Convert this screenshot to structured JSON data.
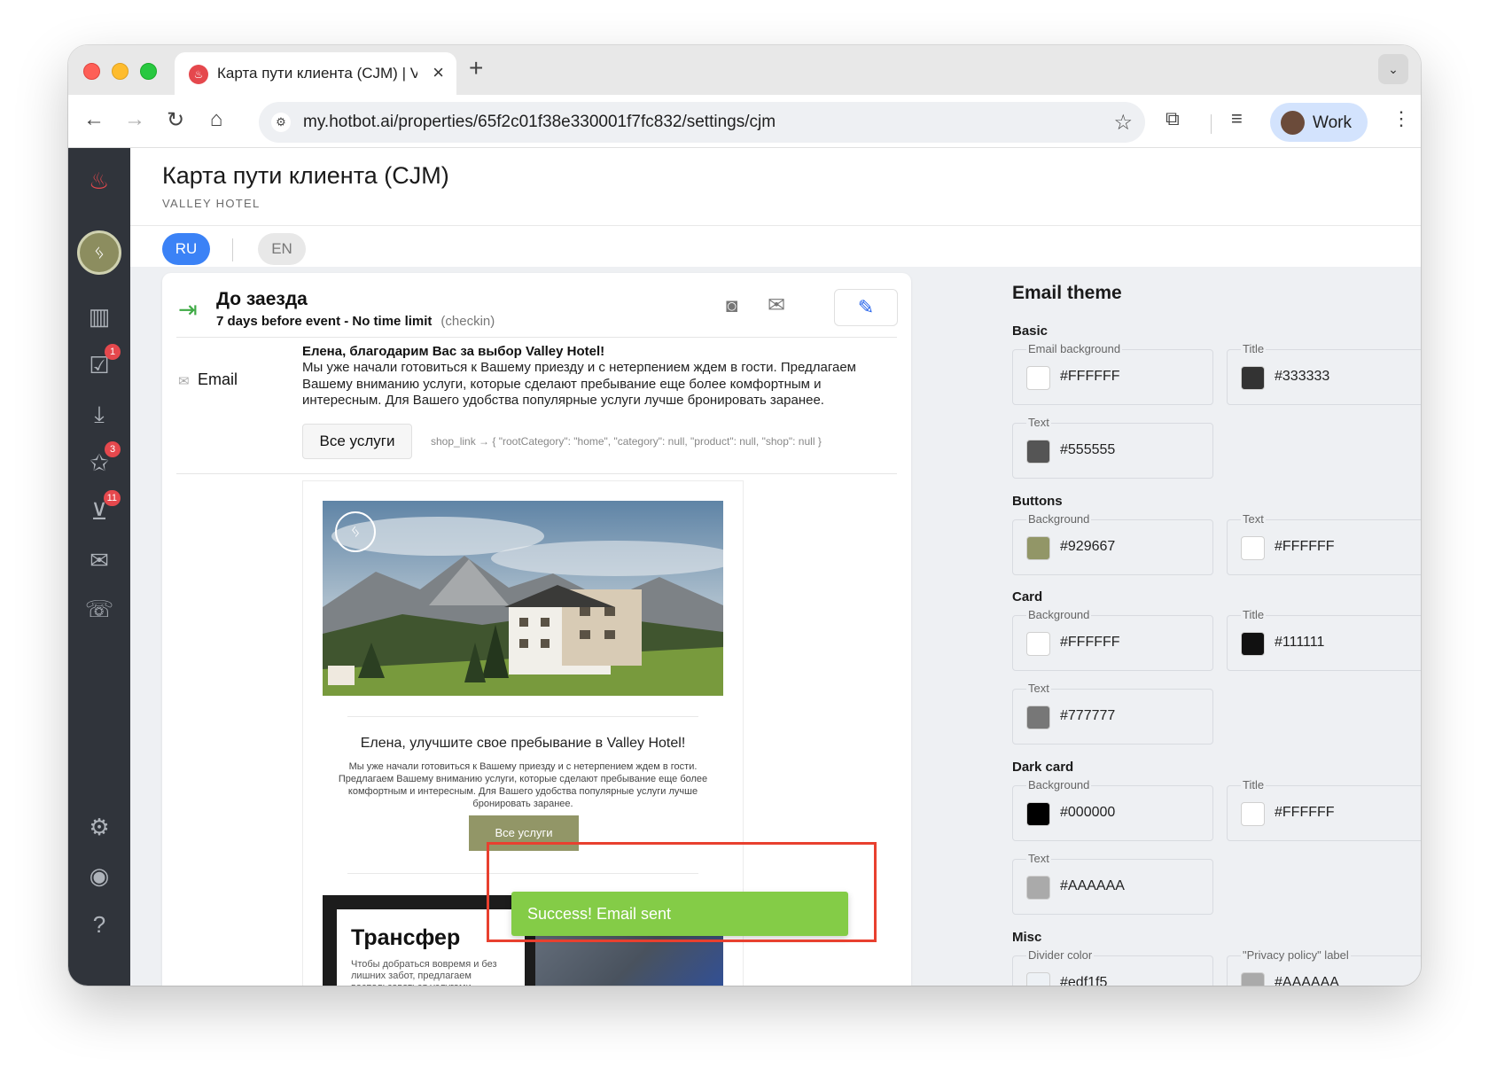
{
  "browser": {
    "tab_title": "Карта пути клиента (CJM) | V",
    "url": "my.hotbot.ai/properties/65f2c01f38e330001f7fc832/settings/cjm",
    "profile_label": "Work"
  },
  "sidebar": {
    "badges": {
      "tasks": "1",
      "reviews": "3",
      "shop": "11"
    }
  },
  "header": {
    "title": "Карта пути клиента (CJM)",
    "subtitle": "VALLEY HOTEL"
  },
  "languages": {
    "active": "RU",
    "inactive": "EN"
  },
  "step": {
    "title": "До заезда",
    "timing": "7 days before event - No time limit",
    "type": "(checkin)",
    "channel": "Email",
    "message_title": "Елена, благодарим Вас за выбор Valley Hotel!",
    "message_body": "Мы уже начали готовиться к Вашему приезду и с нетерпением ждем в гости. Предлагаем Вашему вниманию услуги, которые сделают пребывание еще более комфортным и интересным. Для Вашего удобства популярные услуги лучше бронировать заранее.",
    "button_label": "Все услуги",
    "button_link": "shop_link → { \"rootCategory\": \"home\", \"category\": null, \"product\": null, \"shop\": null }"
  },
  "email_preview": {
    "title": "Елена, улучшите свое пребывание в Valley Hotel!",
    "body": "Мы уже начали готовиться к Вашему приезду и с нетерпением ждем в гости. Предлагаем Вашему вниманию услуги, которые сделают пребывание еще более комфортным и интересным. Для Вашего удобства популярные услуги лучше бронировать заранее.",
    "button_label": "Все услуги",
    "transfer_title": "Трансфер",
    "transfer_body": "Чтобы добраться вовремя и без лишних забот, предлагаем воспользоваться услугами трансфера."
  },
  "theme": {
    "title": "Email theme",
    "sections": {
      "basic": "Basic",
      "buttons": "Buttons",
      "card": "Card",
      "dark_card": "Dark card",
      "misc": "Misc"
    },
    "fields": {
      "basic_bg": {
        "label": "Email background",
        "value": "#FFFFFF"
      },
      "basic_title": {
        "label": "Title",
        "value": "#333333"
      },
      "basic_text": {
        "label": "Text",
        "value": "#555555"
      },
      "btn_bg": {
        "label": "Background",
        "value": "#929667"
      },
      "btn_text": {
        "label": "Text",
        "value": "#FFFFFF"
      },
      "card_bg": {
        "label": "Background",
        "value": "#FFFFFF"
      },
      "card_title": {
        "label": "Title",
        "value": "#111111"
      },
      "card_text": {
        "label": "Text",
        "value": "#777777"
      },
      "dark_bg": {
        "label": "Background",
        "value": "#000000"
      },
      "dark_title": {
        "label": "Title",
        "value": "#FFFFFF"
      },
      "dark_text": {
        "label": "Text",
        "value": "#AAAAAA"
      },
      "misc_divider": {
        "label": "Divider color",
        "value": "#edf1f5"
      },
      "misc_privacy": {
        "label": "\"Privacy policy\" label",
        "value": "#AAAAAA"
      }
    }
  },
  "toast": {
    "message": "Success! Email sent"
  },
  "colors": {
    "accent": "#3b82f6",
    "brand": "#929667",
    "success": "#84cc47",
    "highlight": "#e8402f",
    "sidebar": "#30343b"
  }
}
